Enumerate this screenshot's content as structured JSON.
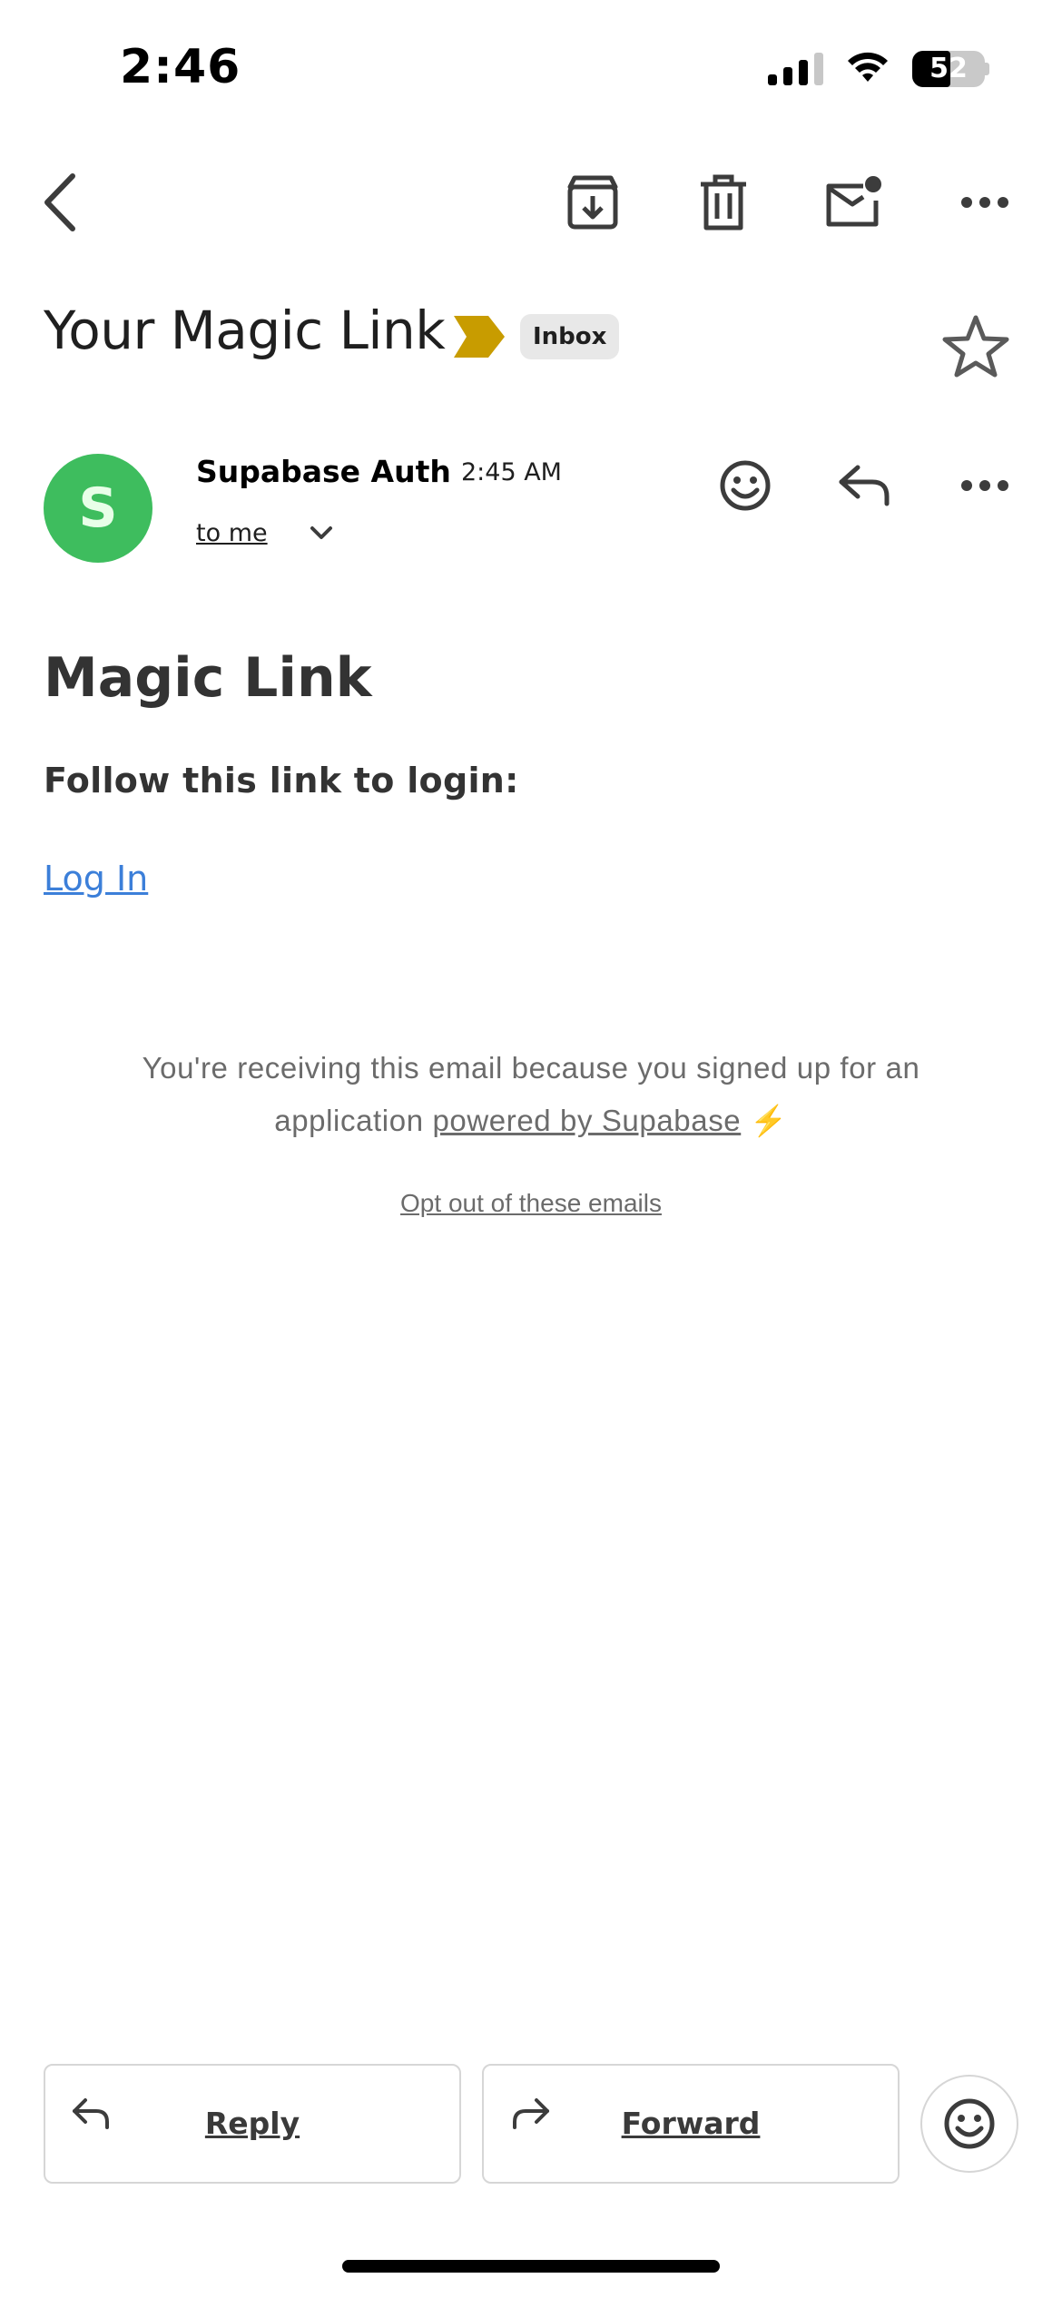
{
  "status_bar": {
    "time": "2:46",
    "battery_level": "52",
    "signal_bars": 4,
    "signal_bars_active": 3,
    "icons": [
      "signal-icon",
      "wifi-icon",
      "battery-icon"
    ]
  },
  "toolbar": {
    "icons": [
      "back-icon",
      "archive-icon",
      "trash-icon",
      "mark-unread-icon",
      "more-icon"
    ]
  },
  "email": {
    "subject": "Your Magic Link",
    "label": "Inbox",
    "importance_color": "#c89c00",
    "sender": {
      "initial": "S",
      "name": "Supabase Auth",
      "time": "2:45 AM",
      "recipient": "to me",
      "avatar_color": "#3ebd5e"
    },
    "body": {
      "heading": "Magic Link",
      "instruction": "Follow this link to login:",
      "link_text": "Log In",
      "footer_text": "You're receiving this email because you signed up for an application",
      "footer_link": "powered by Supabase",
      "footer_emoji": "⚡",
      "opt_out": "Opt out of these emails"
    }
  },
  "actions": {
    "reply_label": "Reply",
    "forward_label": "Forward"
  },
  "colors": {
    "link": "#3c7fd9",
    "text": "#333333",
    "muted": "#6b6b6b"
  }
}
